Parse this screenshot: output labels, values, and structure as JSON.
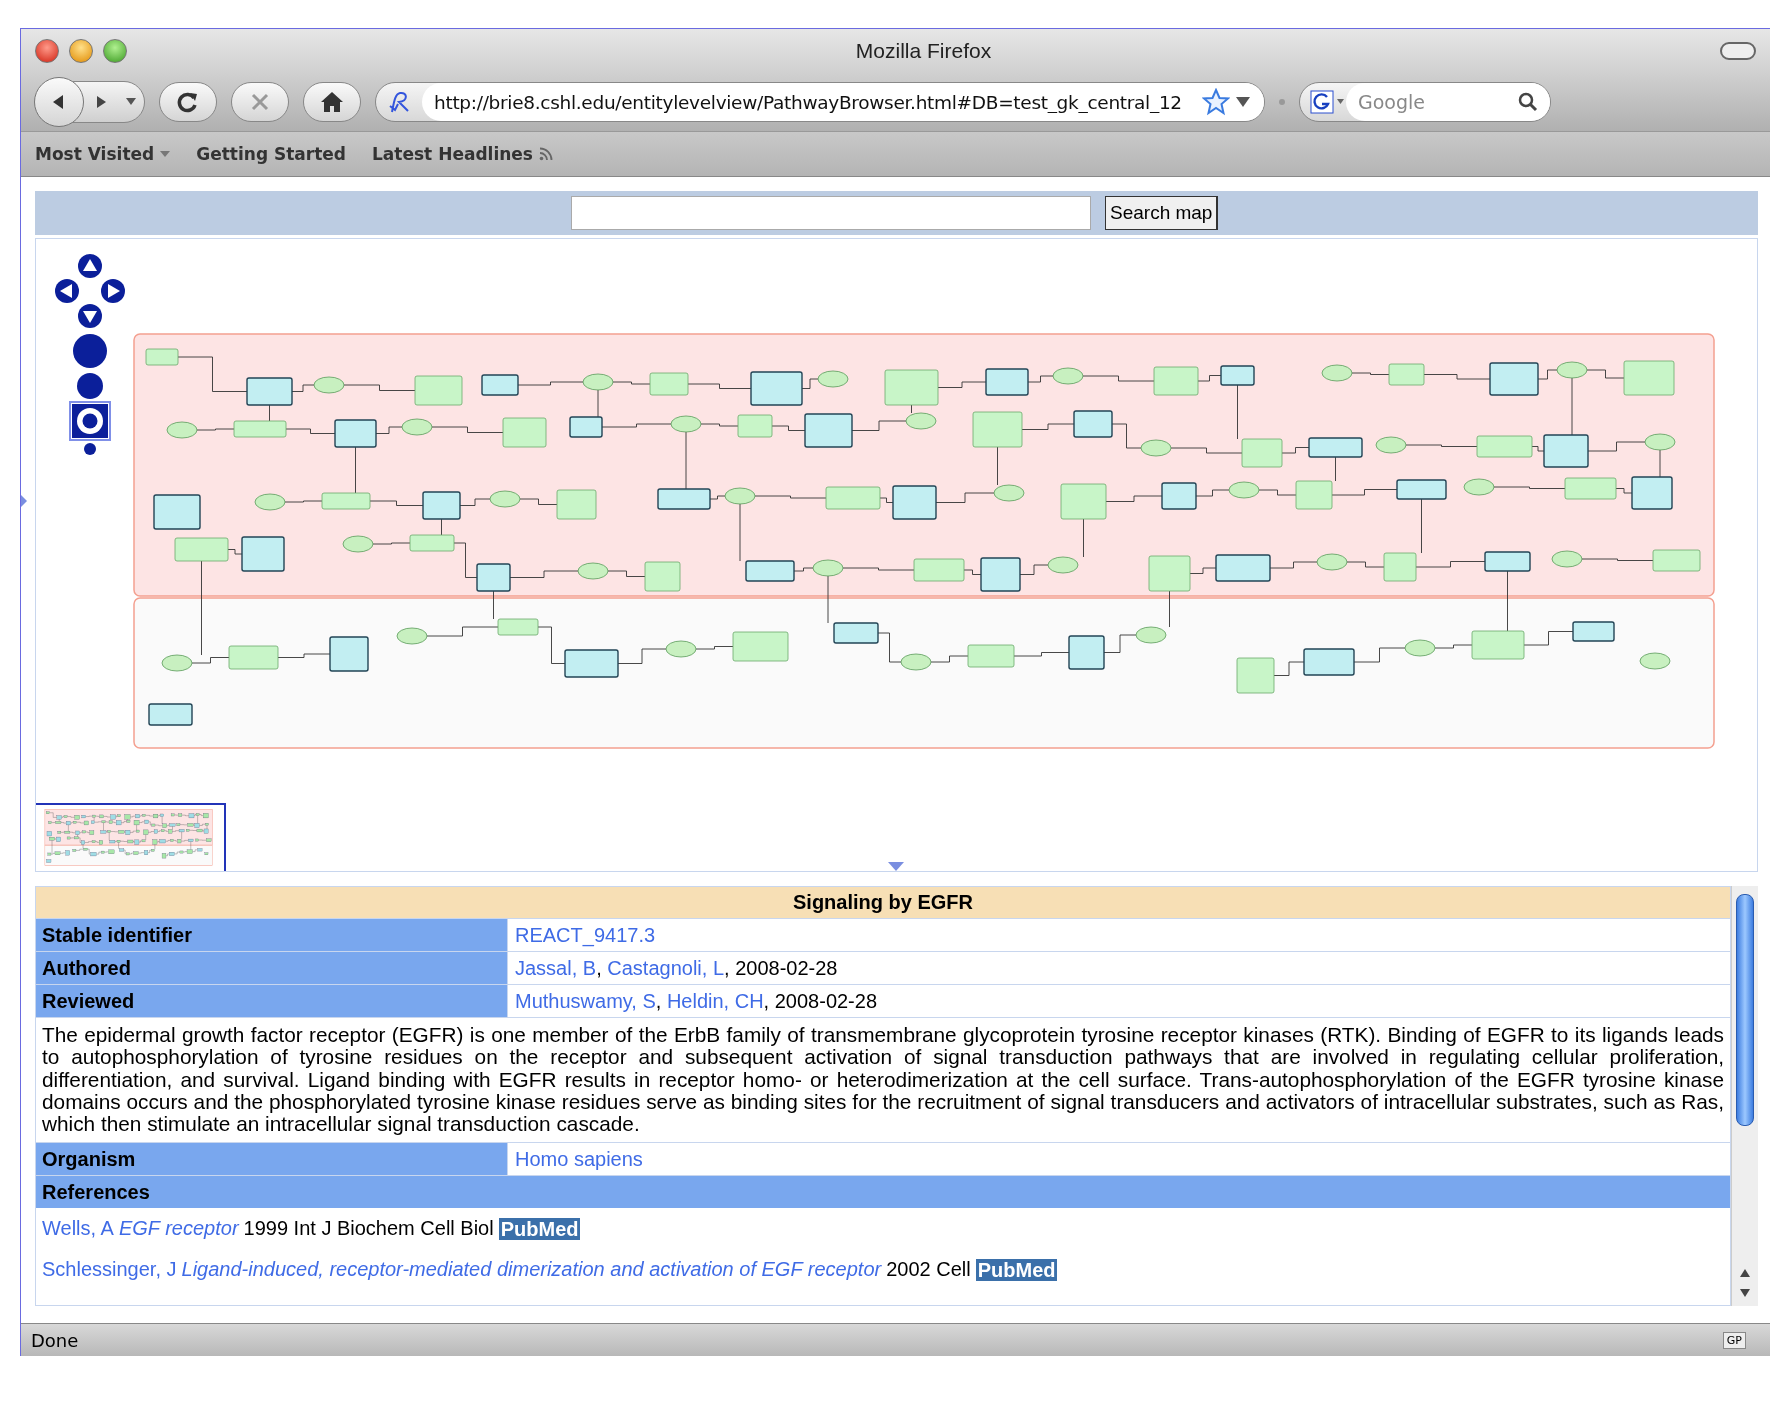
{
  "window": {
    "title": "Mozilla Firefox"
  },
  "toolbar": {
    "url": "http://brie8.cshl.edu/entitylevelview/PathwayBrowser.html#DB=test_gk_central_12",
    "search_placeholder": "Google"
  },
  "bookmarks": [
    {
      "label": "Most Visited",
      "kind": "menu"
    },
    {
      "label": "Getting Started",
      "kind": "link"
    },
    {
      "label": "Latest Headlines",
      "kind": "feed"
    }
  ],
  "search_map": {
    "button": "Search map"
  },
  "navigator": {
    "zoom_levels": [
      {
        "selected": false
      },
      {
        "selected": false
      },
      {
        "selected": true
      },
      {
        "selected": false
      }
    ]
  },
  "details": {
    "title": "Signaling by EGFR",
    "rows": [
      {
        "kind": "field",
        "label": "Stable identifier",
        "parts": [
          {
            "text": "REACT_9417.3",
            "link": true
          }
        ]
      },
      {
        "kind": "field",
        "label": "Authored",
        "parts": [
          {
            "text": "Jassal, B",
            "link": true
          },
          {
            "text": ", ",
            "link": false
          },
          {
            "text": "Castagnoli, L",
            "link": true
          },
          {
            "text": ", 2008-02-28",
            "link": false
          }
        ]
      },
      {
        "kind": "field",
        "label": "Reviewed",
        "parts": [
          {
            "text": "Muthuswamy, S",
            "link": true
          },
          {
            "text": ", ",
            "link": false
          },
          {
            "text": "Heldin, CH",
            "link": true
          },
          {
            "text": ", 2008-02-28",
            "link": false
          }
        ]
      },
      {
        "kind": "description",
        "text": "The epidermal growth factor receptor (EGFR) is one member of the ErbB family of transmembrane glycoprotein tyrosine receptor kinases (RTK). Binding of EGFR to its ligands leads to autophosphorylation of tyrosine residues on the receptor and subsequent activation of signal transduction pathways that are involved in regulating cellular proliferation, differentiation, and survival. Ligand binding with EGFR results in receptor homo- or heterodimerization at the cell surface. Trans-autophosphorylation of the EGFR tyrosine kinase domains occurs and the phosphorylated tyrosine kinase residues serve as binding sites for the recruitment of signal transducers and activators of intracellular substrates, such as Ras, which then stimulate an intracellular signal transduction cascade."
      },
      {
        "kind": "field",
        "label": "Organism",
        "parts": [
          {
            "text": "Homo sapiens",
            "link": true
          }
        ]
      },
      {
        "kind": "heading",
        "label": "References"
      }
    ],
    "references": [
      {
        "author": "Wells, A",
        "title": "EGF receptor",
        "source": "1999 Int J Biochem Cell Biol",
        "badge": "PubMed"
      },
      {
        "author": "Schlessinger, J",
        "title": "Ligand-induced, receptor-mediated dimerization and activation of EGF receptor",
        "source": "2002 Cell",
        "badge": "PubMed"
      }
    ]
  },
  "status_bar": {
    "text": "Done",
    "badge": "GP"
  }
}
